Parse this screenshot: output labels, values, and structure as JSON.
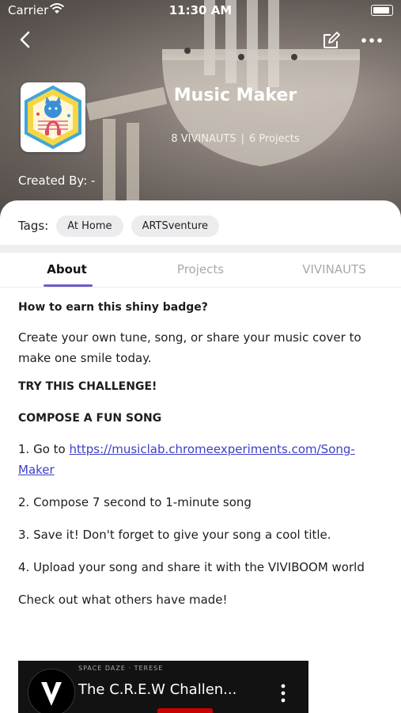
{
  "status_bar": {
    "carrier": "Carrier",
    "time": "11:30 AM"
  },
  "header": {
    "title": "Music Maker",
    "vivinauts_count": "8 VIVINAUTS",
    "separator": "|",
    "projects_count": "6 Projects",
    "created_by": "Created By: -"
  },
  "icons": {
    "back": "chevron-left-icon",
    "edit": "edit-icon",
    "more": "more-horizontal-icon"
  },
  "tags": {
    "label": "Tags:",
    "items": [
      "At Home",
      "ARTSventure"
    ]
  },
  "tabs": [
    {
      "label": "About",
      "active": true
    },
    {
      "label": "Projects",
      "active": false
    },
    {
      "label": "VIVINAUTS",
      "active": false
    }
  ],
  "about": {
    "question": "How to earn this shiny badge?",
    "intro": "Create your own tune, song, or share your music cover to make one smile today.",
    "challenge_heading": "TRY THIS CHALLENGE!",
    "compose_heading": "COMPOSE A FUN SONG",
    "step1_prefix": "1. Go to ",
    "step1_link": "https://musiclab.chromeexperiments.com/Song-Maker",
    "step2": "2. Compose 7 second to 1-minute song",
    "step3": "3. Save it! Don't forget to give your song a cool title.",
    "step4": "4. Upload your song and share it with the VIVIBOOM world",
    "outro": "Check out what others have made!"
  },
  "video": {
    "small_text": "SPACE DAZE · TERESE",
    "title": "The C.R.E.W Challen..."
  },
  "colors": {
    "accent": "#6d5acf",
    "link": "#3c3fc9",
    "chip_bg": "#ececee"
  }
}
